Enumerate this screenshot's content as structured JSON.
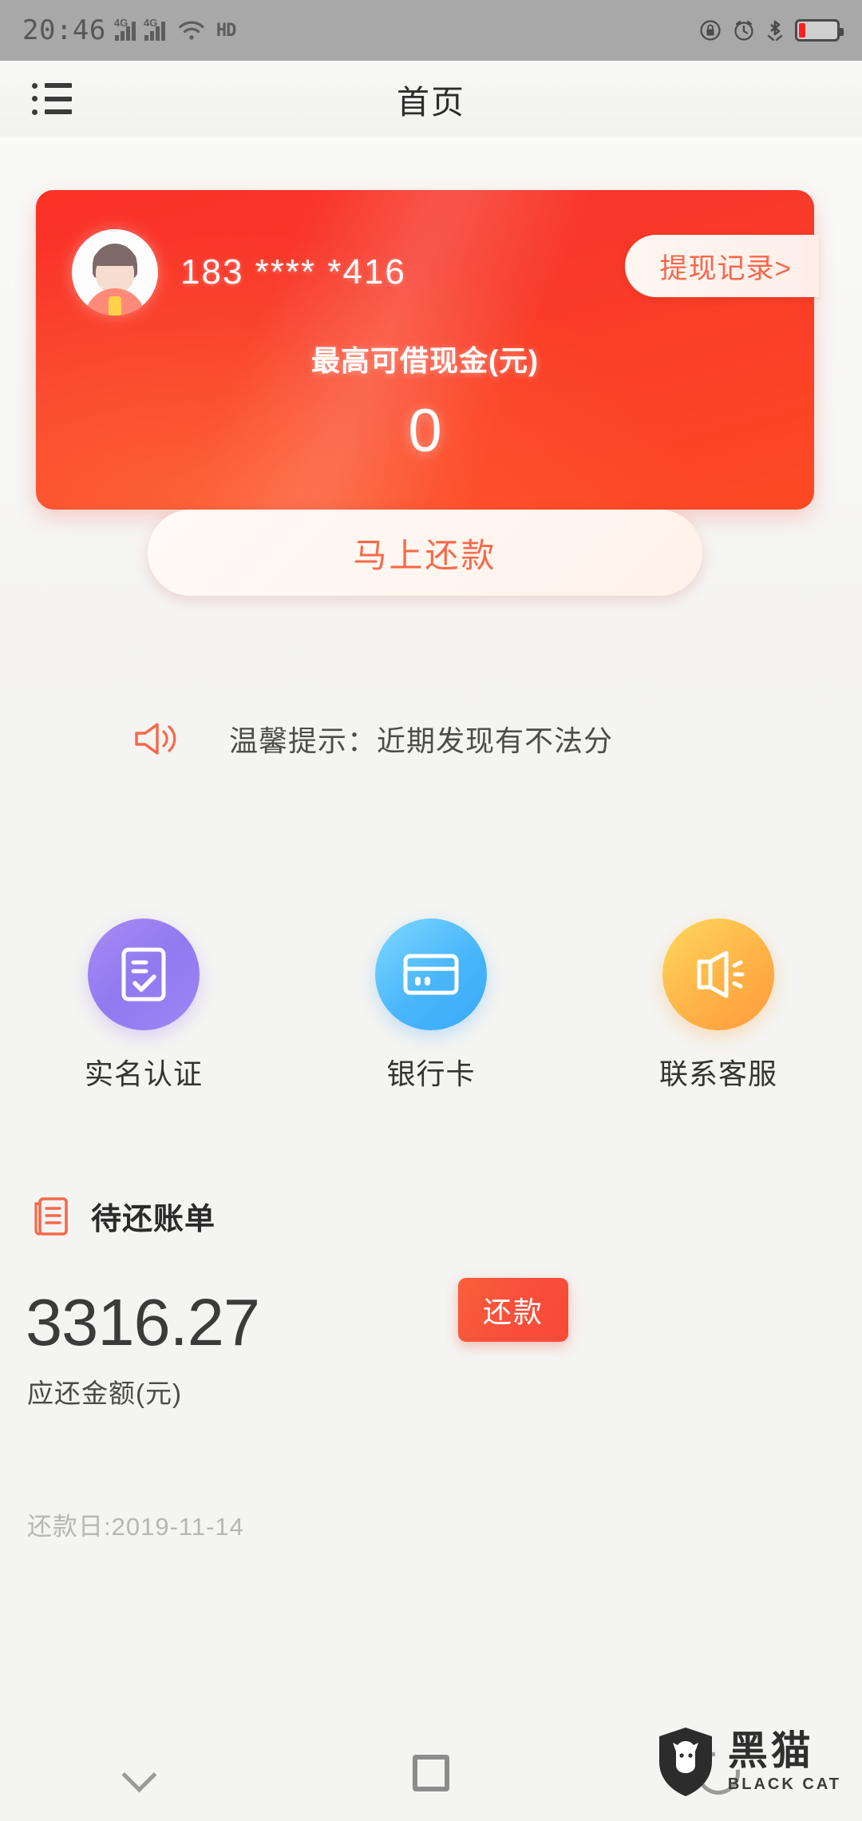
{
  "status_bar": {
    "time": "20:46",
    "network_label": "4G",
    "hd_label": "HD",
    "icons_left": [
      "signal-4g-icon",
      "signal-4g-icon",
      "wifi-icon",
      "hd-icon"
    ],
    "icons_right": [
      "lock-icon",
      "alarm-icon",
      "bluetooth-icon",
      "battery-icon"
    ],
    "battery_level_percent": 18,
    "battery_color": "#ff1f1f"
  },
  "header": {
    "title": "首页",
    "menu_icon": "list-menu-icon"
  },
  "credit_card": {
    "phone_number": "183 **** *416",
    "withdraw_record_label": "提现记录>",
    "limit_label": "最高可借现金(元)",
    "limit_amount": "0",
    "repay_now_label": "马上还款",
    "accent_color": "#fb3126",
    "button_text_color": "#f76a4a"
  },
  "notice": {
    "icon": "megaphone-icon",
    "text": "温馨提示：近期发现有不法分",
    "icon_color": "#f7684a"
  },
  "shortcuts": [
    {
      "label": "实名认证",
      "icon": "id-document-check-icon",
      "color": "#9b82f3"
    },
    {
      "label": "银行卡",
      "icon": "credit-card-icon",
      "color": "#49b6fb"
    },
    {
      "label": "联系客服",
      "icon": "megaphone-icon",
      "color": "#ffb347"
    }
  ],
  "bill": {
    "section_icon": "bill-list-icon",
    "section_title": "待还账单",
    "amount": "3316.27",
    "amount_label": "应还金额(元)",
    "repay_button_label": "还款",
    "repay_button_color": "#f8503a",
    "repay_date": "还款日:2019-11-14"
  },
  "nav_bar": {
    "back_icon": "chevron-down-back-icon",
    "home_icon": "square-home-icon",
    "recent_icon": "circle-recent-icon"
  },
  "watermark": {
    "icon": "black-cat-shield-icon",
    "cn": "黑猫",
    "en": "BLACK CAT"
  }
}
